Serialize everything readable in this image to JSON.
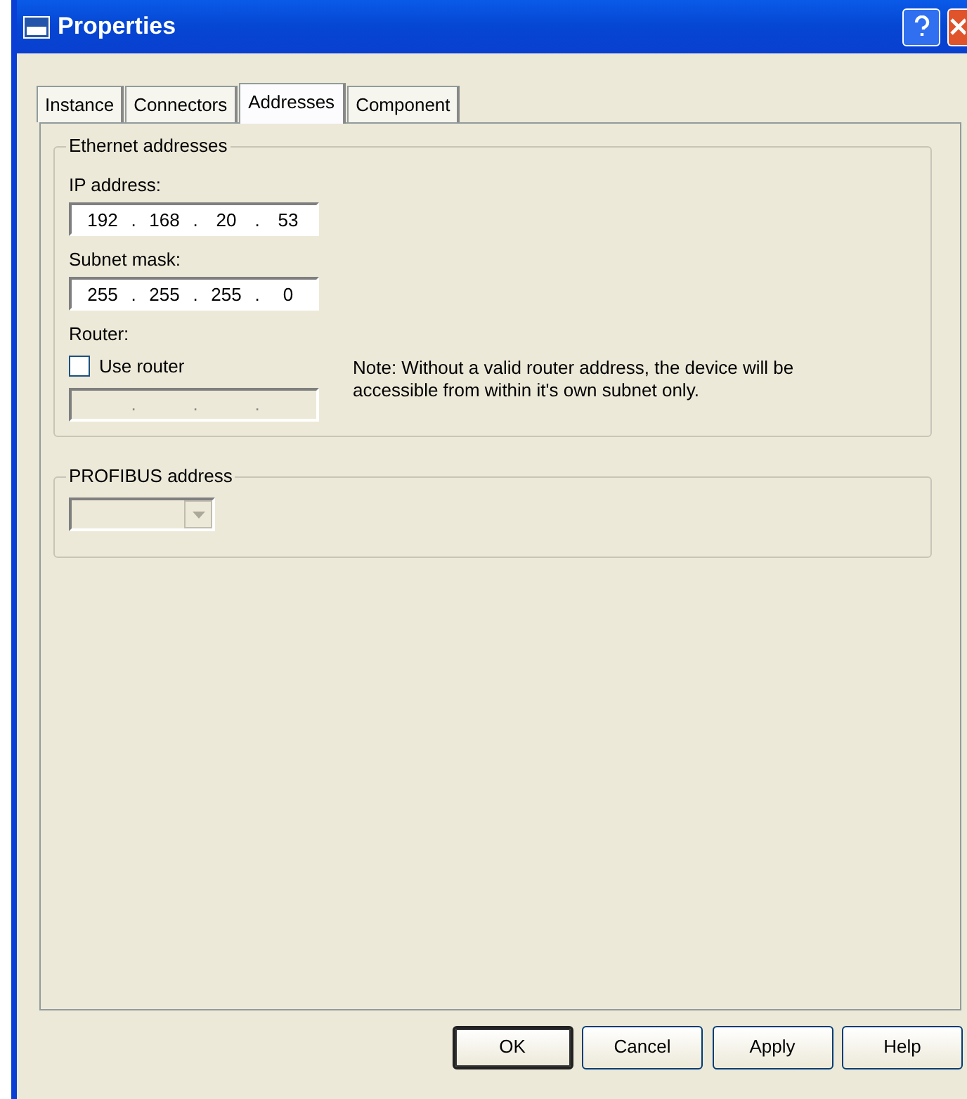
{
  "window": {
    "title": "Properties"
  },
  "tabs": [
    {
      "label": "Instance",
      "selected": false
    },
    {
      "label": "Connectors",
      "selected": false
    },
    {
      "label": "Addresses",
      "selected": true
    },
    {
      "label": "Component",
      "selected": false
    }
  ],
  "ethernet": {
    "title": "Ethernet addresses",
    "ip_label": "IP address:",
    "ip_address": [
      "192",
      ".",
      "168",
      ".",
      "20",
      ".",
      "53"
    ],
    "subnet_label": "Subnet mask:",
    "subnet_mask": [
      "255",
      ".",
      "255",
      ".",
      "255",
      ".",
      "0"
    ],
    "router_label": "Router:",
    "use_router": {
      "label": "Use router",
      "checked": false
    },
    "router_address": {
      "parts": [
        ".",
        ".",
        "."
      ],
      "disabled": true
    },
    "note": "Note: Without a valid router address, the device will be accessible from within it's own subnet only."
  },
  "profibus": {
    "title": "PROFIBUS address",
    "dropdown": {
      "disabled": true
    }
  },
  "buttons": [
    {
      "label": "OK",
      "default": true
    },
    {
      "label": "Cancel",
      "default": false
    },
    {
      "label": "Apply",
      "default": false
    },
    {
      "label": "Help",
      "default": false
    }
  ]
}
